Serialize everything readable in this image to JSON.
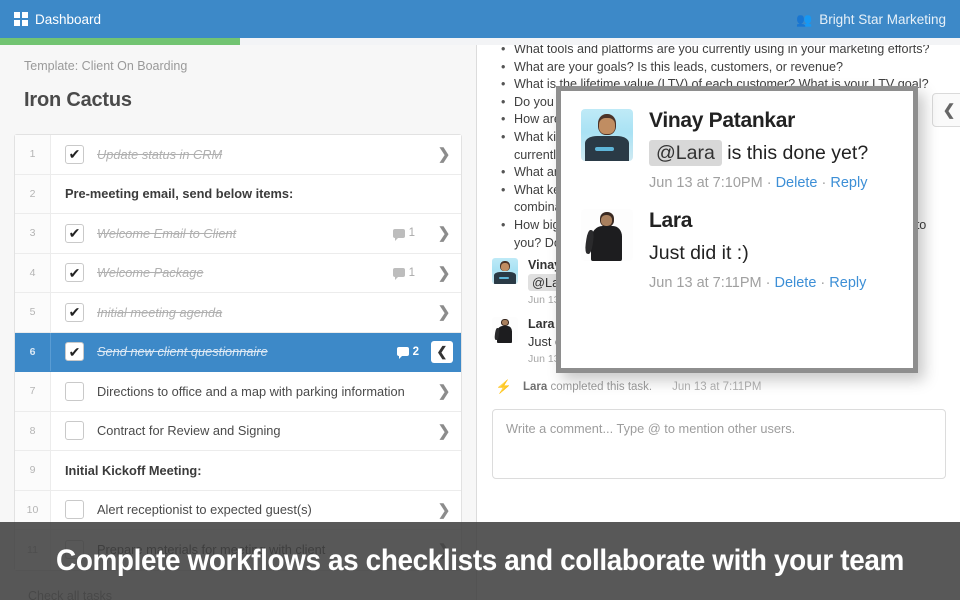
{
  "navbar": {
    "brand_label": "Dashboard",
    "brand_icon": "grid-icon",
    "org_label": "Bright Star Marketing",
    "org_icon": "people-icon",
    "background_color": "#3d89c8"
  },
  "progress": {
    "percent": 25,
    "fill_color": "#72c472",
    "track_color": "#f3f4f6"
  },
  "left_panel": {
    "template_label": "Template: Client On Boarding",
    "project_title": "Iron Cactus",
    "check_all_label": "Check all tasks",
    "items": [
      {
        "num": "1",
        "label": "Update status in CRM",
        "checked": true,
        "type": "task",
        "comments": "",
        "selected": false
      },
      {
        "num": "2",
        "label": "Pre-meeting email, send below items:",
        "checked": false,
        "type": "section",
        "comments": "",
        "selected": false
      },
      {
        "num": "3",
        "label": "Welcome Email to Client",
        "checked": true,
        "type": "task",
        "comments": "1",
        "selected": false
      },
      {
        "num": "4",
        "label": "Welcome Package",
        "checked": true,
        "type": "task",
        "comments": "1",
        "selected": false
      },
      {
        "num": "5",
        "label": "Initial meeting agenda",
        "checked": true,
        "type": "task",
        "comments": "",
        "selected": false
      },
      {
        "num": "6",
        "label": "Send new client questionnaire",
        "checked": true,
        "type": "task",
        "comments": "2",
        "selected": true
      },
      {
        "num": "7",
        "label": "Directions to office and a map with parking information",
        "checked": false,
        "type": "task",
        "comments": "",
        "selected": false
      },
      {
        "num": "8",
        "label": "Contract for Review and Signing",
        "checked": false,
        "type": "task",
        "comments": "",
        "selected": false
      },
      {
        "num": "9",
        "label": "Initial Kickoff Meeting:",
        "checked": false,
        "type": "section",
        "comments": "",
        "selected": false
      },
      {
        "num": "10",
        "label": "Alert receptionist to expected guest(s)",
        "checked": false,
        "type": "task",
        "comments": "",
        "selected": false
      },
      {
        "num": "11",
        "label": "Prepare materials for meeting with client",
        "checked": false,
        "type": "task",
        "comments": "",
        "selected": false
      }
    ],
    "checkmark_glyph": "✔",
    "chevron_glyph": "❯",
    "collapse_glyph": "❮"
  },
  "right_panel": {
    "questions": [
      "What tools and platforms are you currently using in your marketing efforts?",
      "What are your goals? Is this leads, customers, or revenue?",
      "What is the lifetime value (LTV) of each customer? What is your LTV goal?",
      "Do you currently have a marketing budget? If so, what is it?",
      "How are you currently tracking your marketing efforts and results?",
      "What kind of content are you currently producing? How often are you currently investing in content creation?",
      "What are your biggest marketing challenges and roadblocks?",
      "What keywords and search terms do you want to rank for? What combinations of those have you tried?",
      "How big do you want your business to be? What does success look like to you? Do you know your churn rate?"
    ],
    "collapse_glyph": "❮",
    "thread": [
      {
        "author": "Vinay Patankar",
        "mention": "@Lara",
        "text": " is this done yet?",
        "time": "Jun 13 at 7:10PM",
        "delete_label": "Delete",
        "reply_label": "Reply",
        "separator": "·",
        "avatar": "avatar-vinay"
      },
      {
        "author": "Lara",
        "mention": "",
        "text": "Just did it :)",
        "time": "Jun 13 at 7:11PM",
        "delete_label": "Delete",
        "reply_label": "Reply",
        "separator": "·",
        "avatar": "avatar-lara"
      }
    ],
    "activity": {
      "icon": "bolt-icon",
      "actor": "Lara",
      "action": " completed this task.",
      "time": "Jun 13 at 7:11PM"
    },
    "comment_box_placeholder": "Write a comment... Type @ to mention other users."
  },
  "popup": {
    "comments": [
      {
        "author": "Vinay Patankar",
        "mention": "@Lara",
        "text": " is this done yet?",
        "time": "Jun 13 at 7:10PM",
        "separator_1": "·",
        "delete_label": "Delete",
        "separator_2": "·",
        "reply_label": "Reply",
        "avatar": "avatar-vinay"
      },
      {
        "author": "Lara",
        "mention": "",
        "text": "Just did it :)",
        "time": "Jun 13 at 7:11PM",
        "separator_1": "·",
        "delete_label": "Delete",
        "separator_2": "·",
        "reply_label": "Reply",
        "avatar": "avatar-lara"
      }
    ]
  },
  "caption": {
    "text": "Complete workflows as checklists and collaborate with your team"
  }
}
